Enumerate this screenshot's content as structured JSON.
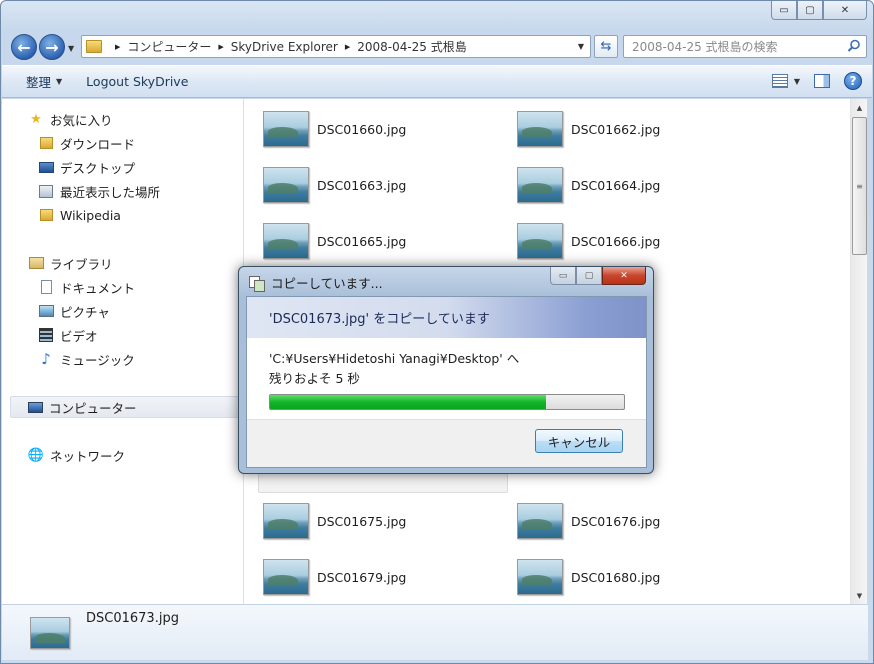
{
  "window": {
    "caption_buttons": {
      "minimize": "▭",
      "maximize": "▢",
      "close": "✕"
    }
  },
  "navbar": {
    "back_icon": "arrow-left-icon",
    "forward_icon": "arrow-right-icon",
    "breadcrumbs": [
      "コンピューター",
      "SkyDrive Explorer",
      "2008-04-25 式根島"
    ],
    "search_placeholder": "2008-04-25 式根島の検索"
  },
  "cmdbar": {
    "organize_label": "整理",
    "logout_label": "Logout SkyDrive"
  },
  "navpane": {
    "favorites": {
      "label": "お気に入り",
      "items": [
        "ダウンロード",
        "デスクトップ",
        "最近表示した場所",
        "Wikipedia"
      ]
    },
    "libraries": {
      "label": "ライブラリ",
      "items": [
        "ドキュメント",
        "ピクチャ",
        "ビデオ",
        "ミュージック"
      ]
    },
    "computer_label": "コンピューター",
    "network_label": "ネットワーク"
  },
  "files": [
    "DSC01660.jpg",
    "DSC01662.jpg",
    "DSC01663.jpg",
    "DSC01664.jpg",
    "DSC01665.jpg",
    "DSC01666.jpg",
    "DSC01675.jpg",
    "DSC01676.jpg",
    "DSC01679.jpg",
    "DSC01680.jpg"
  ],
  "details": {
    "filename": "DSC01673.jpg"
  },
  "dialog": {
    "title": "コピーしています...",
    "header": "'DSC01673.jpg' をコピーしています",
    "destination": "'C:¥Users¥Hidetoshi Yanagi¥Desktop' へ",
    "remaining": "残りおよそ 5 秒",
    "progress_fraction": 0.78,
    "cancel_label": "キャンセル",
    "colors": {
      "progress": "#14b62a"
    }
  }
}
